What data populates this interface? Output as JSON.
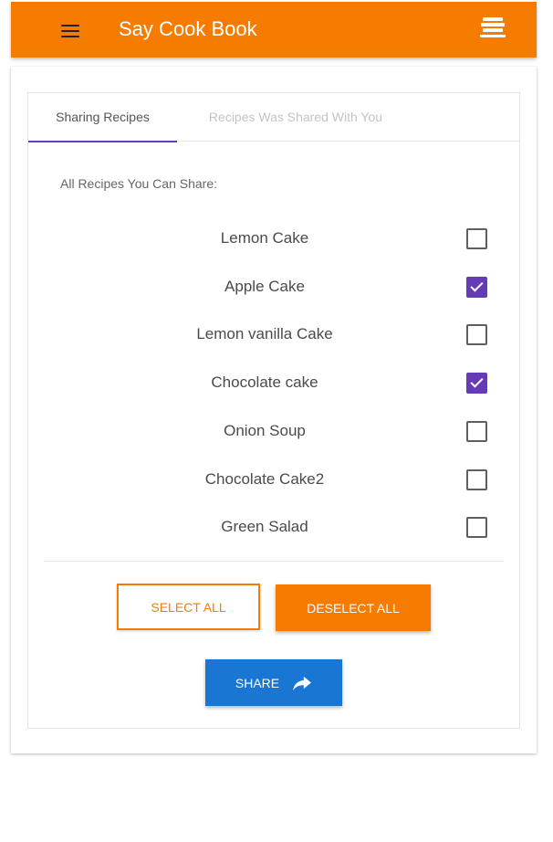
{
  "app": {
    "title": "Say Cook Book"
  },
  "tabs": [
    {
      "label": "Sharing Recipes",
      "active": true
    },
    {
      "label": "Recipes Was Shared With You",
      "active": false
    }
  ],
  "section_label": "All Recipes You Can Share:",
  "recipes": [
    {
      "name": "Lemon Cake",
      "checked": false
    },
    {
      "name": "Apple Cake",
      "checked": true
    },
    {
      "name": "Lemon vanilla Cake",
      "checked": false
    },
    {
      "name": "Chocolate cake",
      "checked": true
    },
    {
      "name": "Onion Soup",
      "checked": false
    },
    {
      "name": "Chocolate Cake2",
      "checked": false
    },
    {
      "name": "Green Salad",
      "checked": false
    }
  ],
  "buttons": {
    "select_all": "SELECT ALL",
    "deselect_all": "DESELECT ALL",
    "share": "SHARE"
  },
  "icons": {
    "menu": "menu-icon",
    "logo": "book-stack-icon",
    "share": "share-arrow-icon"
  },
  "colors": {
    "primary": "#f57c00",
    "accent": "#673ab7",
    "share_button": "#1976d2"
  }
}
